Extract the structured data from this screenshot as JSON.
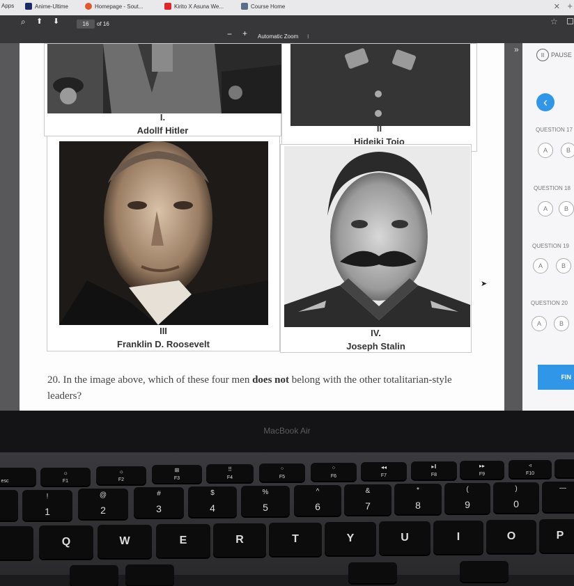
{
  "bookmarks": [
    {
      "label": "Apps",
      "color": "#888888"
    },
    {
      "label": "Anime-Ultime",
      "color": "#1d2a66"
    },
    {
      "label": "Homepage - Sout...",
      "color": "#e0582b"
    },
    {
      "label": "Kirito X Asuna We...",
      "color": "#e0242b"
    },
    {
      "label": "Course Home",
      "color": "#5a6e8a"
    }
  ],
  "pdf_toolbar": {
    "page_current": "16",
    "page_total": "of 16",
    "zoom_out": "−",
    "zoom_in": "+",
    "zoom_level": "Automatic Zoom",
    "zoom_dropdown": "⁝"
  },
  "leaders": [
    {
      "numeral": "I.",
      "name": "Adollf Hitler"
    },
    {
      "numeral": "II",
      "name": "Hideiki Tojo"
    },
    {
      "numeral": "III",
      "name": "Franklin D. Roosevelt"
    },
    {
      "numeral": "IV.",
      "name": "Joseph Stalin"
    }
  ],
  "question": {
    "before": "20. In the image above, which of these four men ",
    "emphasis": "does not",
    "after": " belong with the other totalitarian-style leaders?"
  },
  "side_panel": {
    "collapse": "»",
    "pause_label": "PAUSE",
    "back_arrow": "‹",
    "questions": [
      {
        "label": "QUESTION 17",
        "options": [
          "A",
          "B"
        ]
      },
      {
        "label": "QUESTION 18",
        "options": [
          "A",
          "B"
        ]
      },
      {
        "label": "QUESTION 19",
        "options": [
          "A",
          "B"
        ]
      },
      {
        "label": "QUESTION 20",
        "options": [
          "A",
          "B"
        ]
      }
    ],
    "finish_label": "FIN"
  },
  "laptop": {
    "brand": "MacBook Air"
  },
  "keyboard": {
    "fn_row": [
      {
        "top": "",
        "bot": "",
        "w": "esc"
      },
      {
        "top": "☼",
        "bot": "F1"
      },
      {
        "top": "☼",
        "bot": "F2"
      },
      {
        "top": "⊞",
        "bot": "F3"
      },
      {
        "top": "⠿",
        "bot": "F4"
      },
      {
        "top": "⁘",
        "bot": "F5"
      },
      {
        "top": "⁘",
        "bot": "F6"
      },
      {
        "top": "◂◂",
        "bot": "F7"
      },
      {
        "top": "▸‖",
        "bot": "F8"
      },
      {
        "top": "▸▸",
        "bot": "F9"
      },
      {
        "top": "◃",
        "bot": "F10"
      }
    ],
    "num_row": [
      {
        "top": "!",
        "bot": "1"
      },
      {
        "top": "@",
        "bot": "2"
      },
      {
        "top": "#",
        "bot": "3"
      },
      {
        "top": "$",
        "bot": "4"
      },
      {
        "top": "%",
        "bot": "5"
      },
      {
        "top": "^",
        "bot": "6"
      },
      {
        "top": "&",
        "bot": "7"
      },
      {
        "top": "*",
        "bot": "8"
      },
      {
        "top": "(",
        "bot": "9"
      },
      {
        "top": ")",
        "bot": "0"
      },
      {
        "top": "—",
        "bot": ""
      }
    ],
    "letter_row": [
      "Q",
      "W",
      "E",
      "R",
      "T",
      "Y",
      "U",
      "I",
      "O",
      "P"
    ]
  },
  "colors": {
    "accent_blue": "#2f96e8",
    "page_bg": "#fdfdfd",
    "panel_bg": "#f6f6f8"
  }
}
